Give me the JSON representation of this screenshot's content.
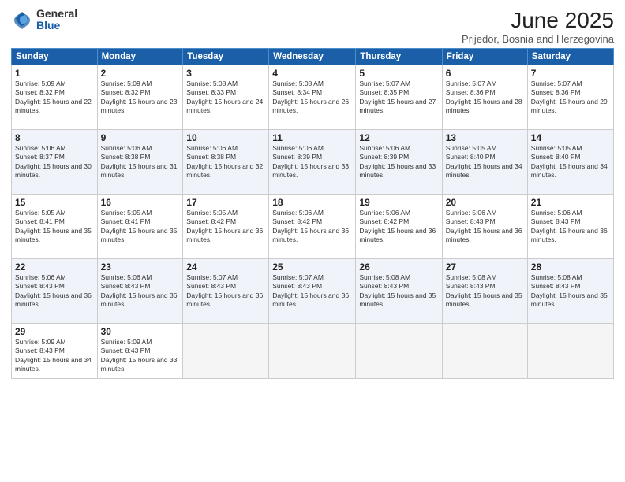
{
  "header": {
    "logo_general": "General",
    "logo_blue": "Blue",
    "title": "June 2025",
    "subtitle": "Prijedor, Bosnia and Herzegovina"
  },
  "days_of_week": [
    "Sunday",
    "Monday",
    "Tuesday",
    "Wednesday",
    "Thursday",
    "Friday",
    "Saturday"
  ],
  "weeks": [
    [
      {
        "day": "1",
        "sunrise": "5:09 AM",
        "sunset": "8:32 PM",
        "daylight": "15 hours and 22 minutes."
      },
      {
        "day": "2",
        "sunrise": "5:09 AM",
        "sunset": "8:32 PM",
        "daylight": "15 hours and 23 minutes."
      },
      {
        "day": "3",
        "sunrise": "5:08 AM",
        "sunset": "8:33 PM",
        "daylight": "15 hours and 24 minutes."
      },
      {
        "day": "4",
        "sunrise": "5:08 AM",
        "sunset": "8:34 PM",
        "daylight": "15 hours and 26 minutes."
      },
      {
        "day": "5",
        "sunrise": "5:07 AM",
        "sunset": "8:35 PM",
        "daylight": "15 hours and 27 minutes."
      },
      {
        "day": "6",
        "sunrise": "5:07 AM",
        "sunset": "8:36 PM",
        "daylight": "15 hours and 28 minutes."
      },
      {
        "day": "7",
        "sunrise": "5:07 AM",
        "sunset": "8:36 PM",
        "daylight": "15 hours and 29 minutes."
      }
    ],
    [
      {
        "day": "8",
        "sunrise": "5:06 AM",
        "sunset": "8:37 PM",
        "daylight": "15 hours and 30 minutes."
      },
      {
        "day": "9",
        "sunrise": "5:06 AM",
        "sunset": "8:38 PM",
        "daylight": "15 hours and 31 minutes."
      },
      {
        "day": "10",
        "sunrise": "5:06 AM",
        "sunset": "8:38 PM",
        "daylight": "15 hours and 32 minutes."
      },
      {
        "day": "11",
        "sunrise": "5:06 AM",
        "sunset": "8:39 PM",
        "daylight": "15 hours and 33 minutes."
      },
      {
        "day": "12",
        "sunrise": "5:06 AM",
        "sunset": "8:39 PM",
        "daylight": "15 hours and 33 minutes."
      },
      {
        "day": "13",
        "sunrise": "5:05 AM",
        "sunset": "8:40 PM",
        "daylight": "15 hours and 34 minutes."
      },
      {
        "day": "14",
        "sunrise": "5:05 AM",
        "sunset": "8:40 PM",
        "daylight": "15 hours and 34 minutes."
      }
    ],
    [
      {
        "day": "15",
        "sunrise": "5:05 AM",
        "sunset": "8:41 PM",
        "daylight": "15 hours and 35 minutes."
      },
      {
        "day": "16",
        "sunrise": "5:05 AM",
        "sunset": "8:41 PM",
        "daylight": "15 hours and 35 minutes."
      },
      {
        "day": "17",
        "sunrise": "5:05 AM",
        "sunset": "8:42 PM",
        "daylight": "15 hours and 36 minutes."
      },
      {
        "day": "18",
        "sunrise": "5:06 AM",
        "sunset": "8:42 PM",
        "daylight": "15 hours and 36 minutes."
      },
      {
        "day": "19",
        "sunrise": "5:06 AM",
        "sunset": "8:42 PM",
        "daylight": "15 hours and 36 minutes."
      },
      {
        "day": "20",
        "sunrise": "5:06 AM",
        "sunset": "8:43 PM",
        "daylight": "15 hours and 36 minutes."
      },
      {
        "day": "21",
        "sunrise": "5:06 AM",
        "sunset": "8:43 PM",
        "daylight": "15 hours and 36 minutes."
      }
    ],
    [
      {
        "day": "22",
        "sunrise": "5:06 AM",
        "sunset": "8:43 PM",
        "daylight": "15 hours and 36 minutes."
      },
      {
        "day": "23",
        "sunrise": "5:06 AM",
        "sunset": "8:43 PM",
        "daylight": "15 hours and 36 minutes."
      },
      {
        "day": "24",
        "sunrise": "5:07 AM",
        "sunset": "8:43 PM",
        "daylight": "15 hours and 36 minutes."
      },
      {
        "day": "25",
        "sunrise": "5:07 AM",
        "sunset": "8:43 PM",
        "daylight": "15 hours and 36 minutes."
      },
      {
        "day": "26",
        "sunrise": "5:08 AM",
        "sunset": "8:43 PM",
        "daylight": "15 hours and 35 minutes."
      },
      {
        "day": "27",
        "sunrise": "5:08 AM",
        "sunset": "8:43 PM",
        "daylight": "15 hours and 35 minutes."
      },
      {
        "day": "28",
        "sunrise": "5:08 AM",
        "sunset": "8:43 PM",
        "daylight": "15 hours and 35 minutes."
      }
    ],
    [
      {
        "day": "29",
        "sunrise": "5:09 AM",
        "sunset": "8:43 PM",
        "daylight": "15 hours and 34 minutes."
      },
      {
        "day": "30",
        "sunrise": "5:09 AM",
        "sunset": "8:43 PM",
        "daylight": "15 hours and 33 minutes."
      },
      null,
      null,
      null,
      null,
      null
    ]
  ],
  "labels": {
    "sunrise": "Sunrise:",
    "sunset": "Sunset:",
    "daylight": "Daylight:"
  }
}
